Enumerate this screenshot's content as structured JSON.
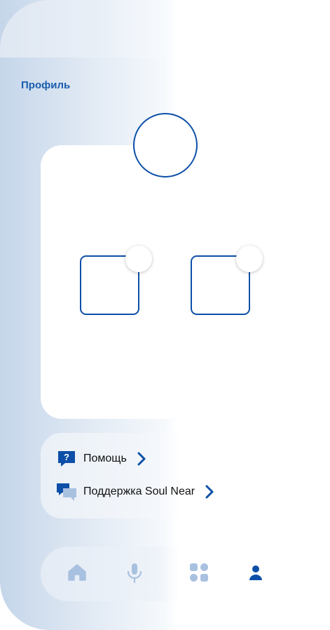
{
  "header": {
    "title": "Профиль"
  },
  "menu": {
    "items": [
      {
        "label": "Помощь",
        "icon": "question-chat-icon"
      },
      {
        "label": "Поддержка Soul Near",
        "icon": "chat-bubbles-icon"
      }
    ]
  },
  "nav": {
    "items": [
      {
        "icon": "home-icon",
        "active": false
      },
      {
        "icon": "microphone-icon",
        "active": false
      },
      {
        "icon": "apps-grid-icon",
        "active": false
      },
      {
        "icon": "user-icon",
        "active": true
      }
    ]
  },
  "colors": {
    "accent": "#0d4fa8",
    "title": "#1a5dad",
    "inactive_icon": "#a9c1e0"
  }
}
